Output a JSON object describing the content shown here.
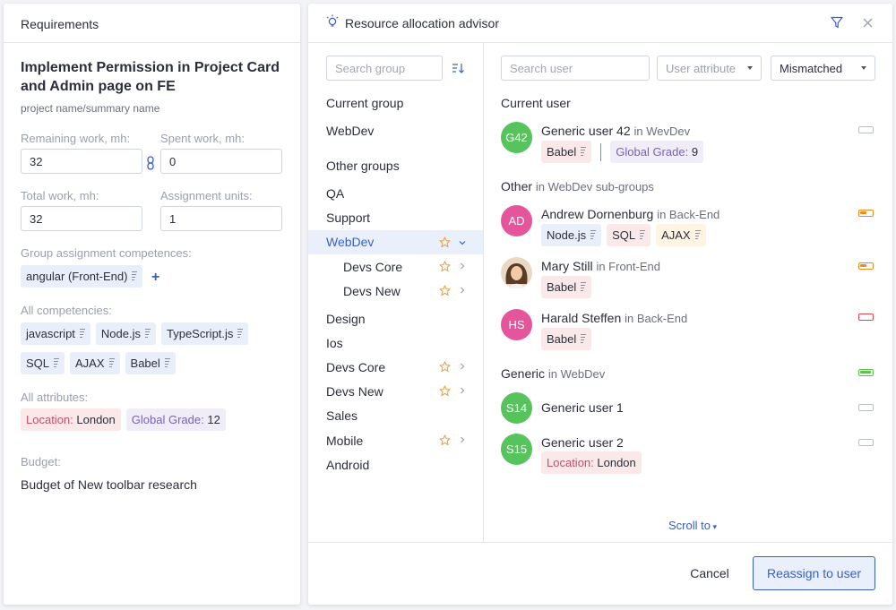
{
  "requirements": {
    "header": "Requirements",
    "task_title": "Implement Permission in Project Card and Admin page on FE",
    "task_subtitle": "project name/summary name",
    "remaining_label": "Remaining work, mh:",
    "remaining_value": "32",
    "spent_label": "Spent work, mh:",
    "spent_value": "0",
    "total_label": "Total work, mh:",
    "total_value": "32",
    "units_label": "Assignment units:",
    "units_value": "1",
    "group_comp_label": "Group assignment competences:",
    "group_comp": [
      "angular (Front-End)"
    ],
    "all_comp_label": "All competencies:",
    "all_comp": [
      "javascript",
      "Node.js",
      "TypeScript.js",
      "SQL",
      "AJAX",
      "Babel"
    ],
    "all_attr_label": "All attributes:",
    "attr_location_key": "Location:",
    "attr_location_val": "London",
    "attr_grade_key": "Global Grade:",
    "attr_grade_val": "12",
    "budget_label": "Budget:",
    "budget_value": "Budget of New toolbar research"
  },
  "advisor": {
    "title": "Resource allocation advisor",
    "search_group_placeholder": "Search group",
    "search_user_placeholder": "Search user",
    "user_attribute": "User attribute",
    "mismatch_filter": "Mismatched",
    "current_group_label": "Current group",
    "current_group": "WebDev",
    "other_groups_label": "Other groups",
    "groups": [
      "QA",
      "Support",
      "WebDev",
      "Devs Core",
      "Devs New",
      "Design",
      "Ios",
      "Devs Core",
      "Devs New",
      "Sales",
      "Mobile",
      "Android"
    ],
    "current_user_label": "Current user",
    "current_user": {
      "initials": "G42",
      "name": "Generic user 42",
      "group": "in WevDev",
      "tag": "Babel",
      "grade_key": "Global Grade:",
      "grade_val": "9"
    },
    "other_label": "Other",
    "other_sub": "in WebDev sub-groups",
    "others": [
      {
        "initials": "AD",
        "name": "Andrew Dornenburg",
        "group": "in Back-End",
        "tags": [
          "Node.js",
          "SQL",
          "AJAX"
        ]
      },
      {
        "initials": "",
        "name": "Mary Still",
        "group": "in Front-End",
        "tags": [
          "Babel"
        ]
      },
      {
        "initials": "HS",
        "name": "Harald Steffen",
        "group": "in Back-End",
        "tags": [
          "Babel"
        ]
      }
    ],
    "generic_label": "Generic",
    "generic_sub": "in WebDev",
    "generic": [
      {
        "initials": "S14",
        "name": "Generic user 1"
      },
      {
        "initials": "S15",
        "name": "Generic user 2",
        "loc_key": "Location:",
        "loc_val": "London"
      }
    ],
    "scroll_to": "Scroll to",
    "cancel": "Cancel",
    "reassign": "Reassign to user"
  },
  "colors": {
    "accent": "#3a5fc4",
    "avatar_green": "#56c35d",
    "avatar_pink": "#e5559b",
    "star": "#e8a13a",
    "batt_orange": "#f08a1c",
    "batt_red": "#e04848",
    "batt_green": "#5cc24a"
  }
}
